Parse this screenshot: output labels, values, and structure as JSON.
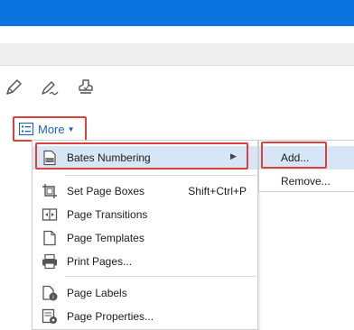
{
  "toolbar": {
    "icons": [
      "pencil-icon",
      "sign-icon",
      "stamp-icon"
    ],
    "more_label": "More"
  },
  "menu": {
    "items": [
      {
        "label": "Bates Numbering",
        "icon": "bates-numbering-icon",
        "has_submenu": true,
        "selected": true
      },
      {
        "label": "Set Page Boxes",
        "icon": "crop-icon",
        "shortcut": "Shift+Ctrl+P"
      },
      {
        "label": "Page Transitions",
        "icon": "page-transitions-icon"
      },
      {
        "label": "Page Templates",
        "icon": "page-templates-icon"
      },
      {
        "label": "Print Pages...",
        "icon": "print-icon"
      },
      {
        "label": "Page Labels",
        "icon": "page-labels-icon"
      },
      {
        "label": "Page Properties...",
        "icon": "page-properties-icon"
      }
    ]
  },
  "submenu": {
    "items": [
      {
        "label": "Add...",
        "selected": true
      },
      {
        "label": "Remove..."
      }
    ]
  },
  "colors": {
    "accent": "#0b74de",
    "highlight_border": "#e0403c",
    "menu_selected": "#d7e6f6"
  }
}
